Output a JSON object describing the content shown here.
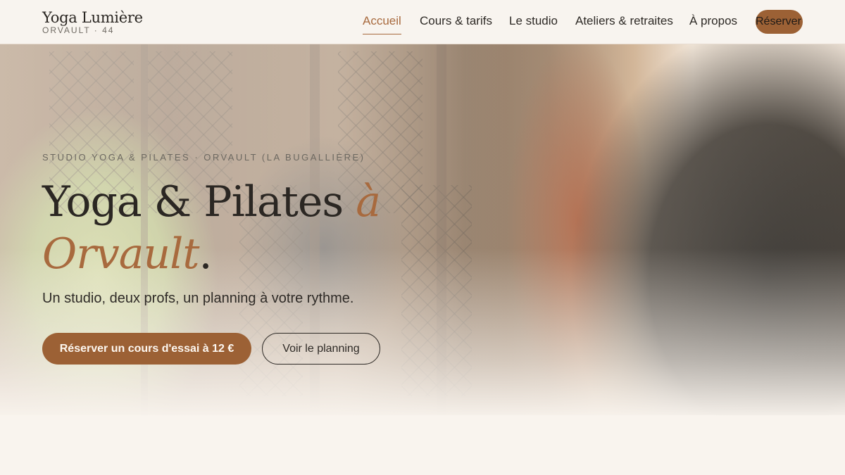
{
  "brand": {
    "name": "Yoga Lumière",
    "location": "ORVAULT · 44"
  },
  "nav": {
    "items": [
      {
        "label": "Accueil",
        "active": true
      },
      {
        "label": "Cours & tarifs",
        "active": false
      },
      {
        "label": "Le studio",
        "active": false
      },
      {
        "label": "Ateliers & retraites",
        "active": false
      },
      {
        "label": "À propos",
        "active": false
      }
    ],
    "cta_label": "Réserver"
  },
  "hero": {
    "eyebrow": "STUDIO YOGA & PILATES · ORVAULT (LA BUGALLIÈRE)",
    "headline": {
      "main": "Yoga & Pilates",
      "accent_line1": "à",
      "accent_line2": "Orvault",
      "end": "."
    },
    "tagline": "Un studio, deux profs, un planning à votre rythme.",
    "primary_cta": "Réserver un cours d'essai à 12 €",
    "secondary_cta": "Voir le planning"
  },
  "colors": {
    "accent": "#a86a3e",
    "button": "#9c6135",
    "background": "#f9f4ee",
    "text": "#2b2723"
  }
}
